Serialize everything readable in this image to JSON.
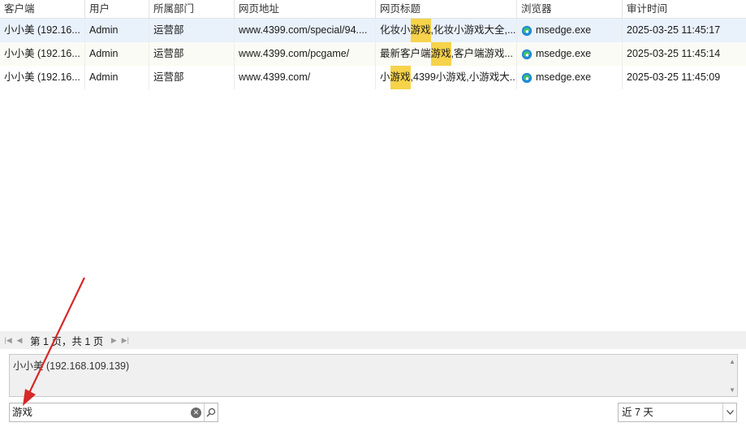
{
  "table": {
    "headers": [
      "客户端",
      "用户",
      "所属部门",
      "网页地址",
      "网页标题",
      "浏览器",
      "审计时间"
    ],
    "rows": [
      {
        "client": "小小美 (192.16...",
        "user": "Admin",
        "dept": "运营部",
        "url": "www.4399.com/special/94....",
        "title_pre": "化妆小",
        "title_hl": "游戏",
        "title_post": ",化妆小游戏大全,...",
        "browser": "msedge.exe",
        "time": "2025-03-25 11:45:17"
      },
      {
        "client": "小小美 (192.16...",
        "user": "Admin",
        "dept": "运营部",
        "url": "www.4399.com/pcgame/",
        "title_pre": "最新客户端",
        "title_hl": "游戏",
        "title_post": ",客户端游戏...",
        "browser": "msedge.exe",
        "time": "2025-03-25 11:45:14"
      },
      {
        "client": "小小美 (192.16...",
        "user": "Admin",
        "dept": "运营部",
        "url": "www.4399.com/",
        "title_pre": "小",
        "title_hl": "游戏",
        "title_post": ",4399小游戏,小游戏大...",
        "browser": "msedge.exe",
        "time": "2025-03-25 11:45:09"
      }
    ]
  },
  "pager": {
    "text": "第 1 页，共 1 页"
  },
  "details": {
    "text": "小小美 (192.168.109.139)"
  },
  "search": {
    "value": "游戏"
  },
  "period": {
    "selected": "近 7 天"
  },
  "colors": {
    "highlight": "#f6d34a",
    "selected_row": "#e9f1fb",
    "annotation_arrow": "#d62828"
  },
  "icons": {
    "browser": "edge-browser-icon",
    "clear": "clear-icon",
    "search": "search-icon",
    "dropdown": "chevron-down-icon"
  }
}
